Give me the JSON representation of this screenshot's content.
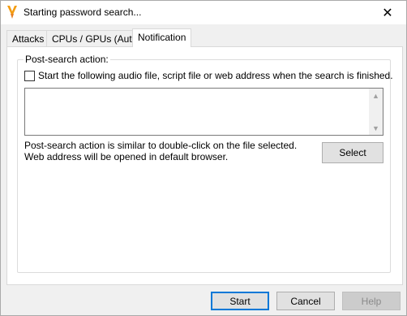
{
  "window": {
    "title": "Starting password search...",
    "close_glyph": "✕"
  },
  "tabs": [
    {
      "label": "Attacks"
    },
    {
      "label": "CPUs / GPUs (Auto)"
    },
    {
      "label": "Notification",
      "active": true
    }
  ],
  "notification": {
    "group_label": "Post-search action:",
    "checkbox_label": "Start the following audio file, script file or web address when the search is finished.",
    "checkbox_checked": false,
    "path_value": "",
    "info_line1": "Post-search action is similar to double-click on the file selected.",
    "info_line2": "Web address will be opened in default browser.",
    "select_label": "Select"
  },
  "footer": {
    "start_label": "Start",
    "cancel_label": "Cancel",
    "help_label": "Help"
  },
  "colors": {
    "accent": "#0078d7",
    "app_icon": "#f39c12"
  }
}
